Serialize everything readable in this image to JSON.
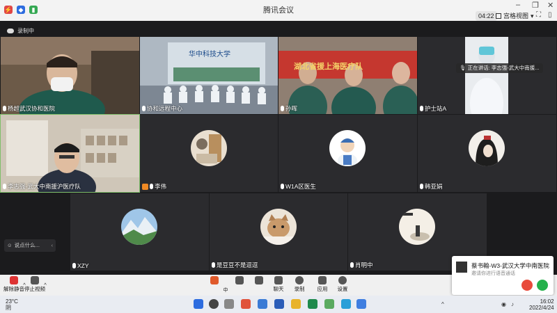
{
  "window": {
    "title": "腾讯会议",
    "timer": "04:22",
    "view_label": "宫格视图",
    "minimize": "–",
    "restore": "❐",
    "close": "✕"
  },
  "recording": {
    "label": "录制中"
  },
  "speaking": {
    "label": "正在讲话: 李志强-武大中南援..."
  },
  "tiles": [
    {
      "name": "杨超武汉协和医院"
    },
    {
      "name": "协和远程中心"
    },
    {
      "name": "孙晖"
    },
    {
      "name": "护士站A"
    },
    {
      "name": "李志强-武大中南援沪医疗队"
    },
    {
      "name": "李伟"
    },
    {
      "name": "W1A区医生"
    },
    {
      "name": "韩亚娟"
    },
    {
      "name": "XZY"
    },
    {
      "name": "是豆豆不是逗逗"
    },
    {
      "name": "肖明中"
    }
  ],
  "scene_text": {
    "banner": "华中科技大学",
    "banner2": "湖北省援上海医疗队"
  },
  "chat": {
    "placeholder": "说点什么..."
  },
  "toolbar": {
    "unmute": "解除静音",
    "stop_video": "停止视频",
    "chat": "聊天",
    "record": "录制",
    "apps": "应用",
    "settings": "设置"
  },
  "notification": {
    "name": "蔡书翰-W3-武汉大学中南医院",
    "sub": "邀请你进行语音通话"
  },
  "weather": {
    "temp": "23°C",
    "desc": "阴"
  },
  "clock": {
    "time": "16:02",
    "date": "2022/4/24"
  },
  "ime": {
    "lang": "中"
  },
  "colors": {
    "accept": "#25b14c",
    "decline": "#e84b3c",
    "accent": "#2d6cdf"
  }
}
